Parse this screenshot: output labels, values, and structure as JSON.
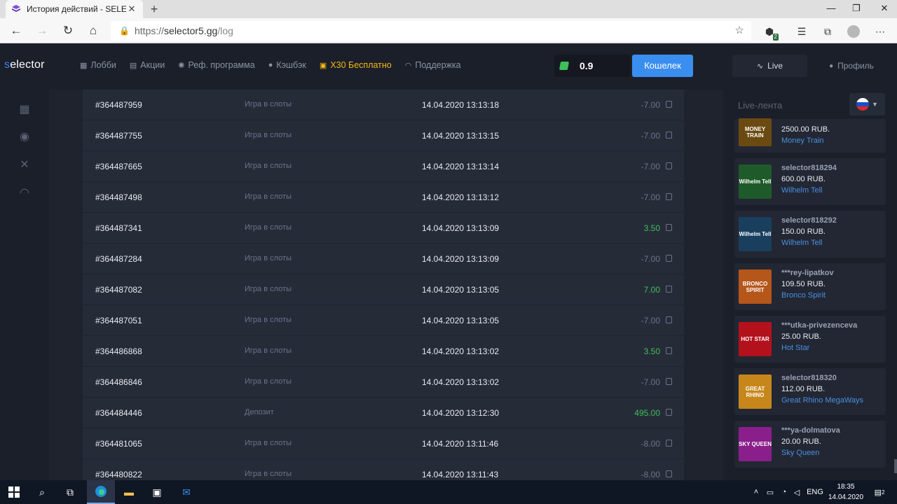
{
  "browser": {
    "tab_title": "История действий - SELECTOR.G",
    "url_scheme": "https://",
    "url_host": "selector5.gg",
    "url_path": "/log",
    "extension_badge": "2"
  },
  "site": {
    "logo_prefix": "s",
    "logo_rest": "elector",
    "nav": [
      {
        "label": "Лобби",
        "icon": "slot-machine-icon"
      },
      {
        "label": "Акции",
        "icon": "promo-icon"
      },
      {
        "label": "Реф. программа",
        "icon": "referral-icon"
      },
      {
        "label": "Кэшбэк",
        "icon": "user-icon"
      },
      {
        "label": "X30 Бесплатно",
        "icon": "gift-icon"
      },
      {
        "label": "Поддержка",
        "icon": "headset-icon"
      }
    ],
    "balance": "0.9",
    "wallet_label": "Кошелек",
    "live_label": "Live",
    "profile_label": "Профиль"
  },
  "log": [
    {
      "id": "#364487959",
      "type": "Игра в слоты",
      "date": "14.04.2020 13:13:18",
      "amount": "-7.00",
      "positive": false
    },
    {
      "id": "#364487755",
      "type": "Игра в слоты",
      "date": "14.04.2020 13:13:15",
      "amount": "-7.00",
      "positive": false
    },
    {
      "id": "#364487665",
      "type": "Игра в слоты",
      "date": "14.04.2020 13:13:14",
      "amount": "-7.00",
      "positive": false
    },
    {
      "id": "#364487498",
      "type": "Игра в слоты",
      "date": "14.04.2020 13:13:12",
      "amount": "-7.00",
      "positive": false
    },
    {
      "id": "#364487341",
      "type": "Игра в слоты",
      "date": "14.04.2020 13:13:09",
      "amount": "3.50",
      "positive": true
    },
    {
      "id": "#364487284",
      "type": "Игра в слоты",
      "date": "14.04.2020 13:13:09",
      "amount": "-7.00",
      "positive": false
    },
    {
      "id": "#364487082",
      "type": "Игра в слоты",
      "date": "14.04.2020 13:13:05",
      "amount": "7.00",
      "positive": true
    },
    {
      "id": "#364487051",
      "type": "Игра в слоты",
      "date": "14.04.2020 13:13:05",
      "amount": "-7.00",
      "positive": false
    },
    {
      "id": "#364486868",
      "type": "Игра в слоты",
      "date": "14.04.2020 13:13:02",
      "amount": "3.50",
      "positive": true
    },
    {
      "id": "#364486846",
      "type": "Игра в слоты",
      "date": "14.04.2020 13:13:02",
      "amount": "-7.00",
      "positive": false
    },
    {
      "id": "#364484446",
      "type": "Депозит",
      "date": "14.04.2020 13:12:30",
      "amount": "495.00",
      "positive": true
    },
    {
      "id": "#364481065",
      "type": "Игра в слоты",
      "date": "14.04.2020 13:11:46",
      "amount": "-8.00",
      "positive": false
    },
    {
      "id": "#364480822",
      "type": "Игра в слоты",
      "date": "14.04.2020 13:11:43",
      "amount": "-8.00",
      "positive": false
    }
  ],
  "live_feed": {
    "title": "Live-лента",
    "items": [
      {
        "user": "",
        "amount": "2500.00 RUB.",
        "game": "Money Train",
        "thumb_text": "MONEY TRAIN",
        "thumb_color": "#6b4a12"
      },
      {
        "user": "selector818294",
        "amount": "600.00 RUB.",
        "game": "Wilhelm Tell",
        "thumb_text": "Wilhelm Tell",
        "thumb_color": "#1f5a2a"
      },
      {
        "user": "selector818292",
        "amount": "150.00 RUB.",
        "game": "Wilhelm Tell",
        "thumb_text": "Wilhelm Tell",
        "thumb_color": "#1a3f5e"
      },
      {
        "user": "***rey-lipatkov",
        "amount": "109.50 RUB.",
        "game": "Bronco Spirit",
        "thumb_text": "BRONCO SPIRIT",
        "thumb_color": "#b5561b"
      },
      {
        "user": "***utka-privezenceva",
        "amount": "25.00 RUB.",
        "game": "Hot Star",
        "thumb_text": "HOT STAR",
        "thumb_color": "#b3121c"
      },
      {
        "user": "selector818320",
        "amount": "112.00 RUB.",
        "game": "Great Rhino MegaWays",
        "thumb_text": "GREAT RHINO",
        "thumb_color": "#c7861a"
      },
      {
        "user": "***ya-dolmatova",
        "amount": "20.00 RUB.",
        "game": "Sky Queen",
        "thumb_text": "SKY QUEEN",
        "thumb_color": "#8a1f8c"
      }
    ]
  },
  "taskbar": {
    "lang": "ENG",
    "time": "18:35",
    "date": "14.04.2020",
    "notif_count": "2"
  },
  "colors": {
    "accent": "#3a8ef0",
    "positive": "#3fbf5a",
    "promo": "#f5b914",
    "link": "#4a90e2"
  }
}
